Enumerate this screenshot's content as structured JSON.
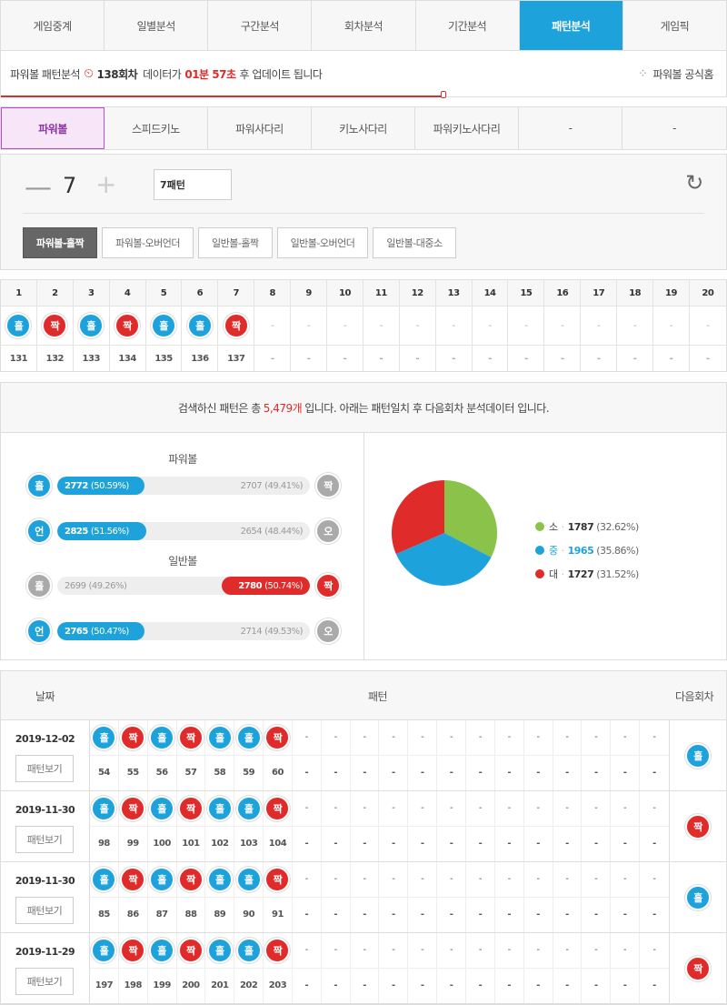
{
  "top_tabs": [
    "게임중계",
    "일별분석",
    "구간분석",
    "회차분석",
    "기간분석",
    "패턴분석",
    "게임픽"
  ],
  "top_active": 5,
  "notice": {
    "prefix": "파워볼 패턴분석",
    "round": "138회차",
    "mid": "데이터가",
    "time": "01분 57초",
    "suffix": "후 업데이트 됩니다",
    "home_link": "파워볼 공식홈"
  },
  "game_tabs": [
    "파워볼",
    "스피드키노",
    "파워사다리",
    "키노사다리",
    "파워키노사다리",
    "-",
    "-"
  ],
  "game_active": 0,
  "control": {
    "minus": "—",
    "count": "7",
    "plus": "+",
    "pattern_value": "7패턴",
    "sub_tabs": [
      "파워볼-홀짝",
      "파워볼-오버언더",
      "일반볼-홀짝",
      "일반볼-오버언더",
      "일반볼-대중소"
    ],
    "sub_active": 0
  },
  "pattern_table": {
    "cols": [
      "1",
      "2",
      "3",
      "4",
      "5",
      "6",
      "7",
      "8",
      "9",
      "10",
      "11",
      "12",
      "13",
      "14",
      "15",
      "16",
      "17",
      "18",
      "19",
      "20"
    ],
    "results": [
      "홀",
      "짝",
      "홀",
      "짝",
      "홀",
      "홀",
      "짝",
      "-",
      "-",
      "-",
      "-",
      "-",
      "-",
      "-",
      "-",
      "-",
      "-",
      "-",
      "-",
      "-"
    ],
    "rounds": [
      "131",
      "132",
      "133",
      "134",
      "135",
      "136",
      "137",
      "-",
      "-",
      "-",
      "-",
      "-",
      "-",
      "-",
      "-",
      "-",
      "-",
      "-",
      "-",
      "-"
    ]
  },
  "summary": {
    "before": "검색하신 패턴은 총",
    "count": "5,479개",
    "after": "입니다. 아래는 패턴일치 후 다음회차 분석데이터 입니다."
  },
  "stats": {
    "powerball_title": "파워볼",
    "normal_title": "일반볼",
    "rows": [
      {
        "left": "홀",
        "right": "짝",
        "lv": "2772",
        "lp": "(50.59%)",
        "rv": "2707",
        "rp": "(49.41%)",
        "win": "left",
        "pct": 50.59
      },
      {
        "left": "언",
        "right": "오",
        "lv": "2825",
        "lp": "(51.56%)",
        "rv": "2654",
        "rp": "(48.44%)",
        "win": "left",
        "pct": 51.56
      },
      {
        "left": "홀",
        "right": "짝",
        "lv": "2699",
        "lp": "(49.26%)",
        "rv": "2780",
        "rp": "(50.74%)",
        "win": "right",
        "pct": 50.74
      },
      {
        "left": "언",
        "right": "오",
        "lv": "2765",
        "lp": "(50.47%)",
        "rv": "2714",
        "rp": "(49.53%)",
        "win": "left",
        "pct": 50.47
      }
    ]
  },
  "pie": {
    "slices": [
      {
        "label": "소",
        "value": 1787,
        "pct": "(32.62%)",
        "color": "#8bc34a"
      },
      {
        "label": "중",
        "value": 1965,
        "pct": "(35.86%)",
        "color": "#1ea2dc"
      },
      {
        "label": "대",
        "value": 1727,
        "pct": "(31.52%)",
        "color": "#e02b2b"
      }
    ]
  },
  "history": {
    "head_date": "날짜",
    "head_pattern": "패턴",
    "head_next": "다음회차",
    "button_label": "패턴보기",
    "rows": [
      {
        "date": "2019-12-02",
        "results": [
          "홀",
          "짝",
          "홀",
          "짝",
          "홀",
          "홀",
          "짝"
        ],
        "rounds": [
          "54",
          "55",
          "56",
          "57",
          "58",
          "59",
          "60"
        ],
        "next": "홀"
      },
      {
        "date": "2019-11-30",
        "results": [
          "홀",
          "짝",
          "홀",
          "짝",
          "홀",
          "홀",
          "짝"
        ],
        "rounds": [
          "98",
          "99",
          "100",
          "101",
          "102",
          "103",
          "104"
        ],
        "next": "짝"
      },
      {
        "date": "2019-11-30",
        "results": [
          "홀",
          "짝",
          "홀",
          "짝",
          "홀",
          "홀",
          "짝"
        ],
        "rounds": [
          "85",
          "86",
          "87",
          "88",
          "89",
          "90",
          "91"
        ],
        "next": "홀"
      },
      {
        "date": "2019-11-29",
        "results": [
          "홀",
          "짝",
          "홀",
          "짝",
          "홀",
          "홀",
          "짝"
        ],
        "rounds": [
          "197",
          "198",
          "199",
          "200",
          "201",
          "202",
          "203"
        ],
        "next": "짝"
      }
    ]
  },
  "colors": {
    "odd": "#1ea2dc",
    "even": "#e02b2b",
    "neutral": "#aaaaaa",
    "accent": "#1ea2dc",
    "game_active": "#8d34a8"
  }
}
